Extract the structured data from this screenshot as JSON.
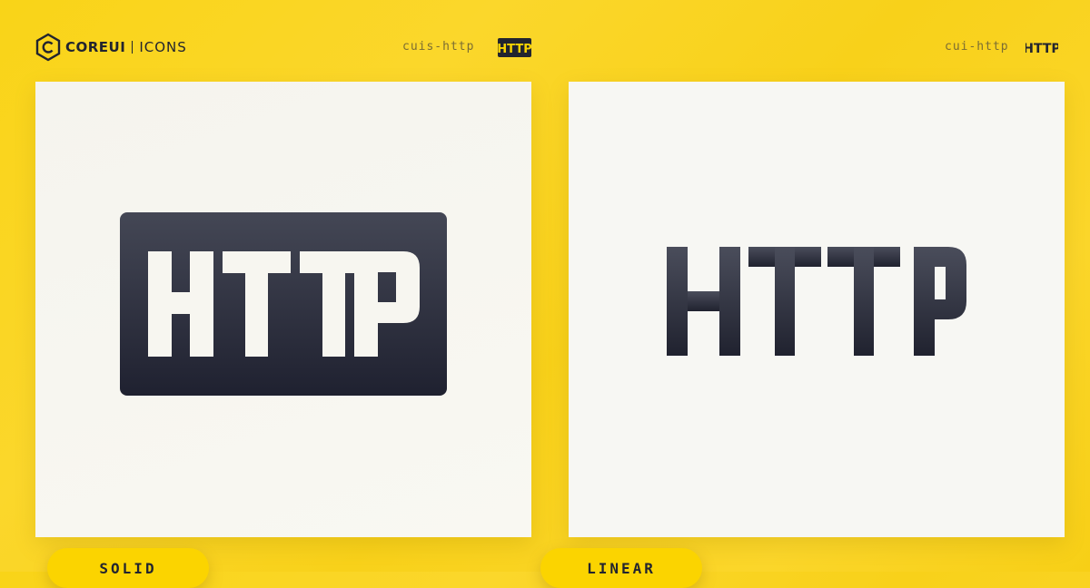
{
  "brand": {
    "core": "COREUI",
    "icons": "ICONS",
    "logo_icon": "coreui-hexagon-logo"
  },
  "solid": {
    "code": "cuis-http",
    "icon": "http-solid-icon",
    "badge_text": "HTTP",
    "label": "SOLID"
  },
  "linear": {
    "code": "cui-http",
    "icon": "http-linear-icon",
    "badge_text": "HTTP",
    "label": "LINEAR"
  },
  "colors": {
    "background": "#f9d418",
    "card": "#f7f6f0",
    "ink": "#22242f",
    "pill": "#fbd400"
  }
}
